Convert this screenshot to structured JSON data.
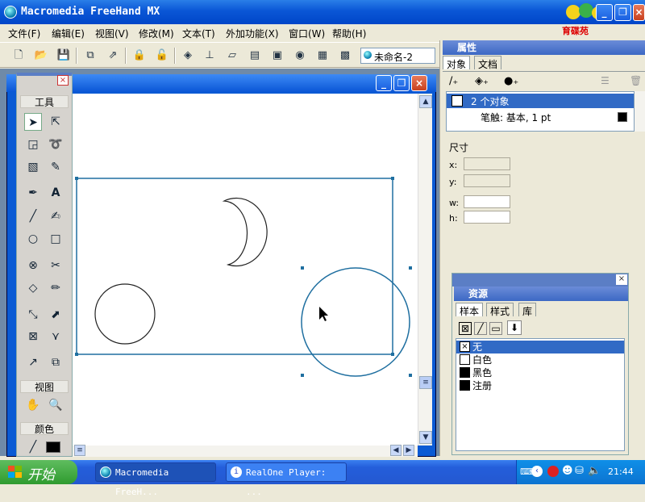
{
  "titlebar": {
    "title": "Macromedia FreeHand MX",
    "logo_text": "育碟苑"
  },
  "menubar": {
    "items": [
      "文件(F)",
      "编辑(E)",
      "视图(V)",
      "修改(M)",
      "文本(T)",
      "外加功能(X)",
      "窗口(W)",
      "帮助(H)"
    ]
  },
  "toolbar": {
    "doc_name": "未命名-2"
  },
  "tools_panel": {
    "title": "工具",
    "view_title": "视图",
    "color_title": "颜色"
  },
  "properties_panel": {
    "title": "属性",
    "tabs": [
      "对象",
      "文档"
    ],
    "objects": [
      {
        "label": "2 个对象"
      },
      {
        "label": "笔触: 基本, 1 pt"
      }
    ],
    "size_label": "尺寸",
    "fields": [
      {
        "label": "x:",
        "value": ""
      },
      {
        "label": "y:",
        "value": ""
      },
      {
        "label": "w:",
        "value": ""
      },
      {
        "label": "h:",
        "value": ""
      }
    ]
  },
  "assets_panel": {
    "title": "资源",
    "tabs": [
      "样本",
      "样式",
      "库"
    ],
    "swatches": [
      {
        "name": "无",
        "color": "none"
      },
      {
        "name": "白色",
        "color": "#ffffff"
      },
      {
        "name": "黑色",
        "color": "#000000"
      },
      {
        "name": "注册",
        "color": "#000000"
      }
    ]
  },
  "taskbar": {
    "start_label": "开始",
    "tasks": [
      {
        "label": "Macromedia FreeH..."
      },
      {
        "label": "RealOne Player: ..."
      }
    ],
    "clock": "21:44"
  },
  "colors": {
    "selection": "#1f6fa0",
    "titlebar": "#0a56d6",
    "start": "#2f9b2f"
  }
}
